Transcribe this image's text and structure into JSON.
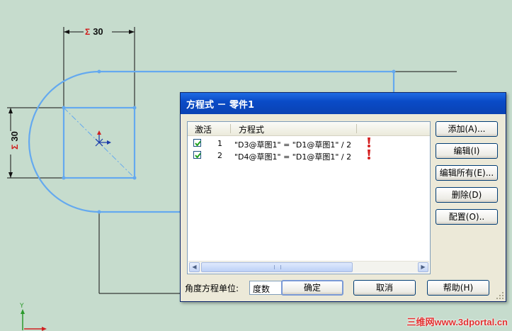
{
  "sketch": {
    "dim_top_value": "30",
    "dim_left_value": "30",
    "sigma_symbol": "Σ",
    "axis_label": "Y"
  },
  "watermark": "三维网www.3dportal.cn",
  "dialog": {
    "title": "方程式 － 零件1",
    "columns": [
      "激活",
      "方程式"
    ],
    "rows": [
      {
        "active": true,
        "index": "1",
        "equation": "\"D3@草图1\" = \"D1@草图1\" / 2",
        "status": "warning"
      },
      {
        "active": true,
        "index": "2",
        "equation": "\"D4@草图1\" = \"D1@草图1\" / 2",
        "status": "warning"
      }
    ],
    "buttons": {
      "add": "添加(A)...",
      "edit": "编辑(I)",
      "edit_all": "编辑所有(E)...",
      "delete": "删除(D)",
      "configure": "配置(O)..",
      "ok": "确定",
      "cancel": "取消",
      "help": "帮助(H)"
    },
    "angle_unit_label": "角度方程单位:",
    "angle_unit_value": "度数"
  },
  "colors": {
    "background": "#c6dccd",
    "sketch_line": "#64a9ef",
    "titlebar": "#0a4bc7",
    "warning": "#d42020"
  }
}
